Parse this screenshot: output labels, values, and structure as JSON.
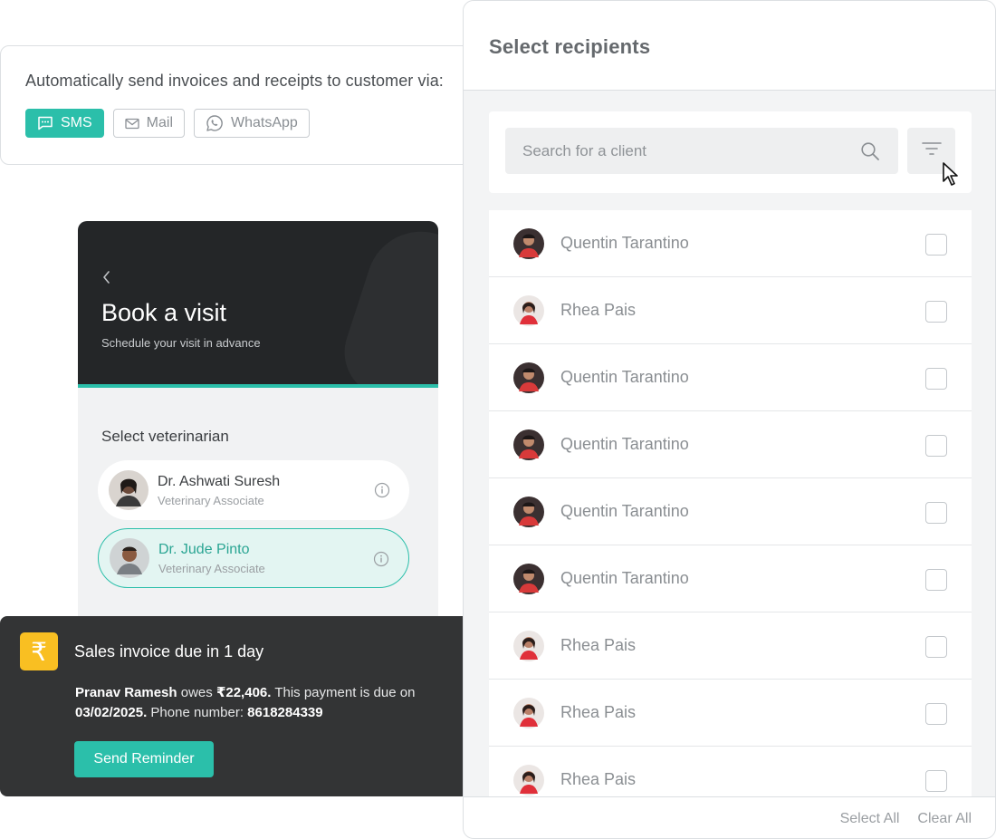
{
  "channels": {
    "title": "Automatically send invoices and receipts to customer via:",
    "options": [
      {
        "label": "SMS",
        "icon": "sms-icon",
        "active": true
      },
      {
        "label": "Mail",
        "icon": "mail-icon",
        "active": false
      },
      {
        "label": "WhatsApp",
        "icon": "whatsapp-icon",
        "active": false
      }
    ]
  },
  "booking": {
    "back_icon": "chevron-left-icon",
    "title": "Book a visit",
    "subtitle": "Schedule your visit in advance",
    "vet_label": "Select veterinarian",
    "vets": [
      {
        "name": "Dr. Ashwati Suresh",
        "role": "Veterinary Associate",
        "selected": false
      },
      {
        "name": "Dr. Jude Pinto",
        "role": "Veterinary Associate",
        "selected": true
      }
    ]
  },
  "invoice": {
    "icon": "₹",
    "title": "Sales invoice due in 1 day",
    "customer": "Pranav Ramesh",
    "owes_text": "owes",
    "amount": "₹22,406.",
    "due_text": "This payment is due on",
    "due_date": "03/02/2025.",
    "phone_label": "Phone number:",
    "phone": "8618284339",
    "button": "Send Reminder"
  },
  "recipients": {
    "title": "Select recipients",
    "search_placeholder": "Search for a client",
    "list": [
      {
        "name": "Quentin Tarantino",
        "checked": false
      },
      {
        "name": "Rhea Pais",
        "checked": false
      },
      {
        "name": "Quentin Tarantino",
        "checked": false
      },
      {
        "name": "Quentin Tarantino",
        "checked": false
      },
      {
        "name": "Quentin Tarantino",
        "checked": false
      },
      {
        "name": "Quentin Tarantino",
        "checked": false
      },
      {
        "name": "Rhea Pais",
        "checked": false
      },
      {
        "name": "Rhea Pais",
        "checked": false
      },
      {
        "name": "Rhea Pais",
        "checked": false
      }
    ],
    "select_all": "Select All",
    "clear_all": "Clear All"
  },
  "colors": {
    "accent": "#2bbfaa",
    "dark": "#242628",
    "toast": "#333435",
    "rupee_badge": "#f9bf22"
  }
}
